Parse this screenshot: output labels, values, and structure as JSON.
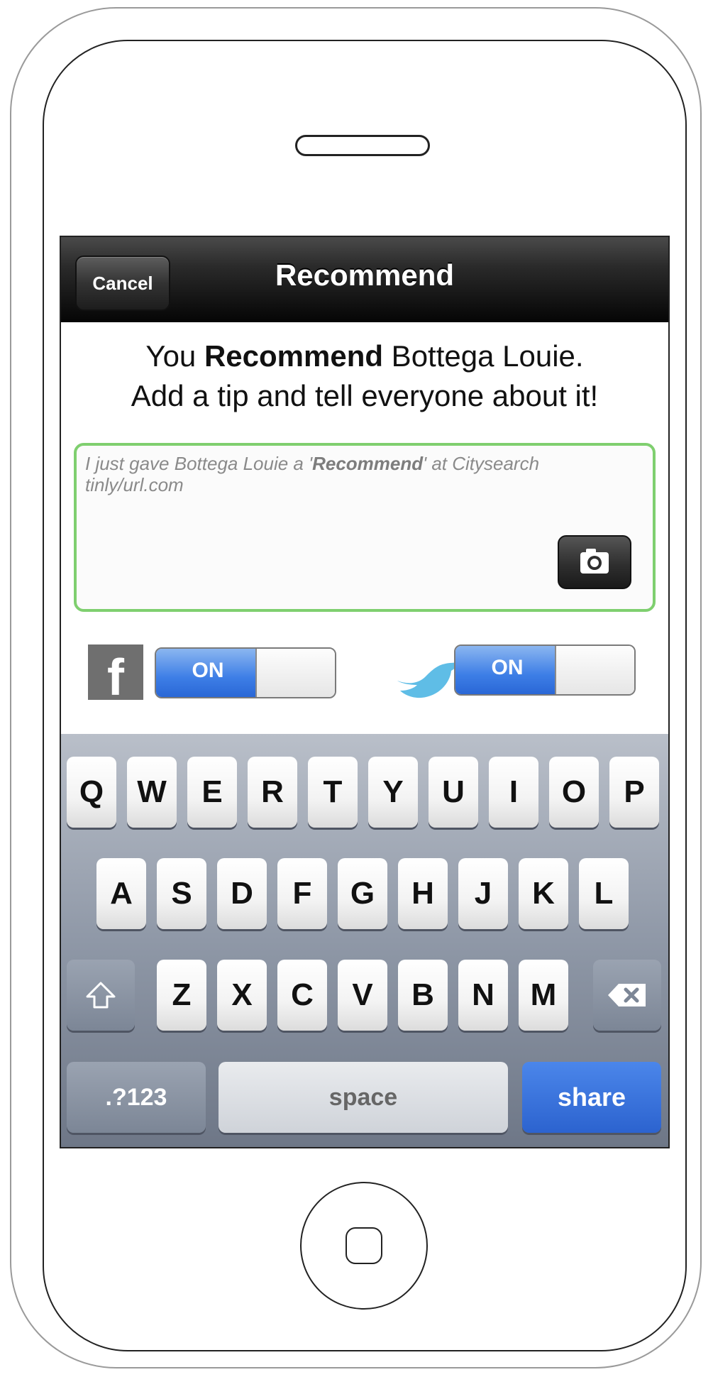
{
  "nav": {
    "title": "Recommend",
    "cancel_label": "Cancel"
  },
  "headline": {
    "line1_prefix": "You ",
    "line1_bold": "Recommend",
    "line1_suffix": " Bottega Louie.",
    "line2": "Add a tip and tell everyone about it!"
  },
  "tip": {
    "placeholder_prefix": "I just gave Bottega Louie a '",
    "placeholder_bold": "Recommend",
    "placeholder_suffix": "' at Citysearch tinly/url.com"
  },
  "social": {
    "facebook": {
      "icon": "facebook-icon",
      "toggle_label": "ON",
      "state": "on"
    },
    "twitter": {
      "icon": "twitter-bird-icon",
      "toggle_label": "ON",
      "state": "on"
    }
  },
  "keyboard": {
    "row1": [
      "Q",
      "W",
      "E",
      "R",
      "T",
      "Y",
      "U",
      "I",
      "O",
      "P"
    ],
    "row2": [
      "A",
      "S",
      "D",
      "F",
      "G",
      "H",
      "J",
      "K",
      "L"
    ],
    "row3": [
      "Z",
      "X",
      "C",
      "V",
      "B",
      "N",
      "M"
    ],
    "shift_icon": "shift-arrow-icon",
    "delete_icon": "backspace-icon",
    "numbers_label": ".?123",
    "space_label": "space",
    "share_label": "share"
  },
  "colors": {
    "tip_border": "#7fcf6f",
    "toggle_on": "#3d7ee6",
    "share_key": "#2c63cf",
    "twitter_bird": "#5fbde6"
  }
}
